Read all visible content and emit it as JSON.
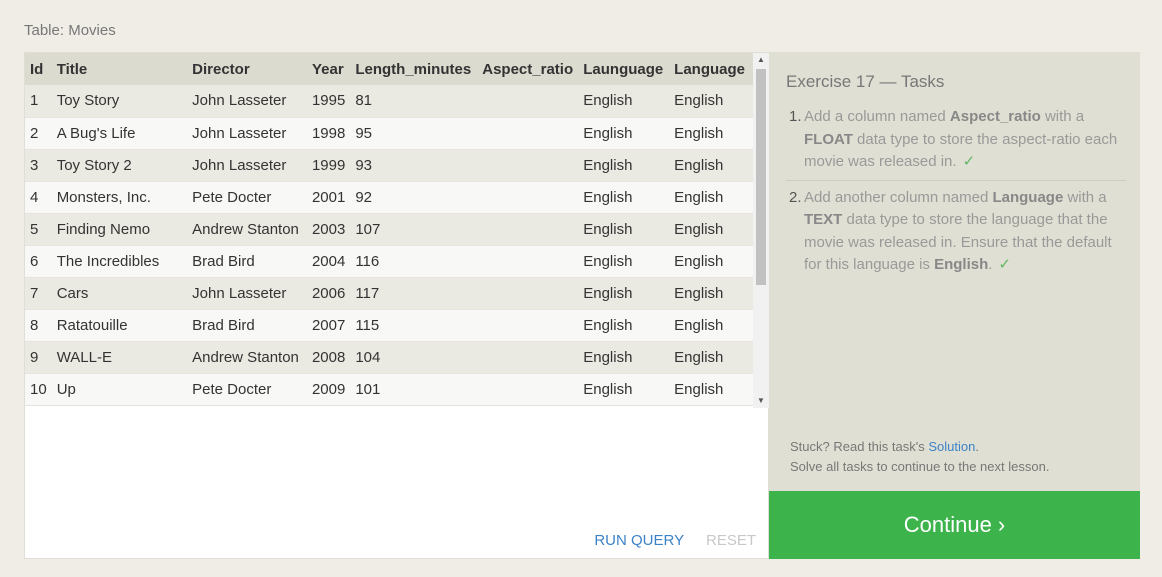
{
  "table_caption": "Table: Movies",
  "columns": [
    "Id",
    "Title",
    "Director",
    "Year",
    "Length_minutes",
    "Aspect_ratio",
    "Launguage",
    "Language"
  ],
  "rows": [
    [
      "1",
      "Toy Story",
      "John Lasseter",
      "1995",
      "81",
      "",
      "English",
      "English"
    ],
    [
      "2",
      "A Bug's Life",
      "John Lasseter",
      "1998",
      "95",
      "",
      "English",
      "English"
    ],
    [
      "3",
      "Toy Story 2",
      "John Lasseter",
      "1999",
      "93",
      "",
      "English",
      "English"
    ],
    [
      "4",
      "Monsters, Inc.",
      "Pete Docter",
      "2001",
      "92",
      "",
      "English",
      "English"
    ],
    [
      "5",
      "Finding Nemo",
      "Andrew Stanton",
      "2003",
      "107",
      "",
      "English",
      "English"
    ],
    [
      "6",
      "The Incredibles",
      "Brad Bird",
      "2004",
      "116",
      "",
      "English",
      "English"
    ],
    [
      "7",
      "Cars",
      "John Lasseter",
      "2006",
      "117",
      "",
      "English",
      "English"
    ],
    [
      "8",
      "Ratatouille",
      "Brad Bird",
      "2007",
      "115",
      "",
      "English",
      "English"
    ],
    [
      "9",
      "WALL-E",
      "Andrew Stanton",
      "2008",
      "104",
      "",
      "English",
      "English"
    ],
    [
      "10",
      "Up",
      "Pete Docter",
      "2009",
      "101",
      "",
      "English",
      "English"
    ]
  ],
  "actions": {
    "run_query": "RUN QUERY",
    "reset": "RESET"
  },
  "exercise": {
    "title": "Exercise 17 — Tasks",
    "tasks": [
      {
        "number": "1.",
        "p1": "Add a column named ",
        "b1": "Aspect_ratio",
        "p2": " with a ",
        "b2": "FLOAT",
        "p3": " data type to store the aspect-ratio each movie was released in.",
        "check": "✓"
      },
      {
        "number": "2.",
        "p1": "Add another column named ",
        "b1": "Language",
        "p2": " with a ",
        "b2": "TEXT",
        "p3": " data type to store the language that the movie was released in. Ensure that the default for this language is ",
        "b3": "English",
        "p4": ".",
        "check": "✓"
      }
    ],
    "stuck_prefix": "Stuck? Read this task's ",
    "solution_link": "Solution",
    "stuck_suffix": ".",
    "solve_all": "Solve all tasks to continue to the next lesson."
  },
  "continue_label": "Continue ›",
  "colors": {
    "accent_green": "#3cb44b",
    "link_blue": "#3b83c8",
    "check_green": "#62b767"
  }
}
